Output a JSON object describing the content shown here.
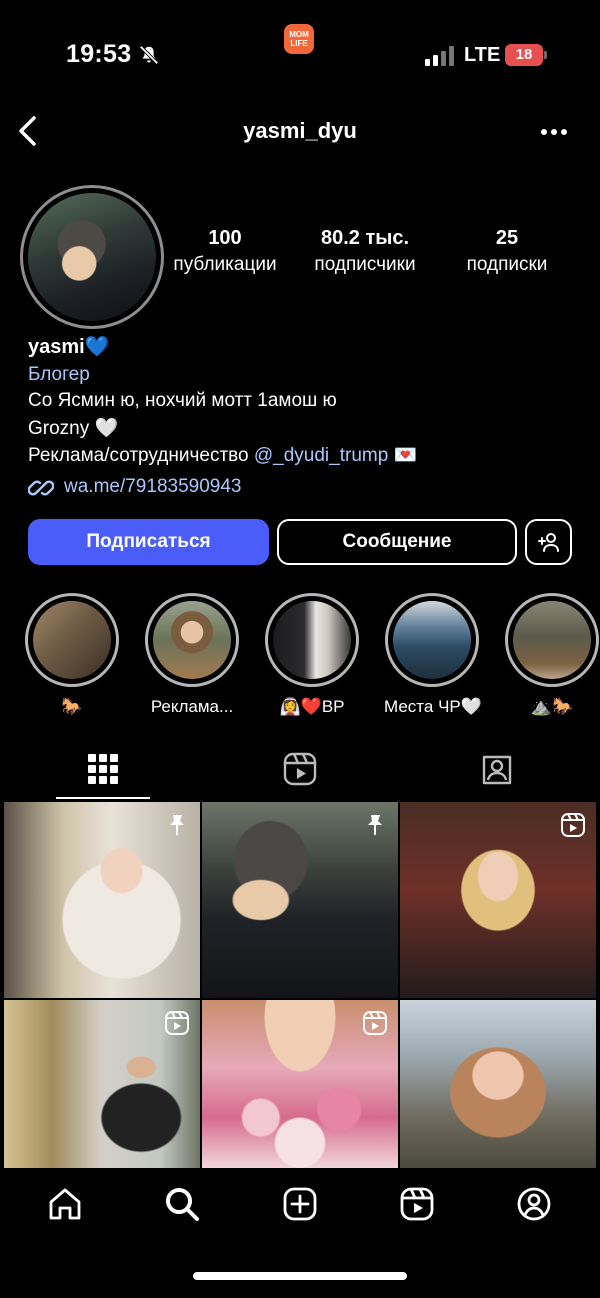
{
  "status_bar": {
    "time": "19:53",
    "app_badge": "MOM\nLIFE",
    "network": "LTE",
    "battery": "18"
  },
  "header": {
    "username": "yasmi_dyu"
  },
  "profile": {
    "stats": [
      {
        "value": "100",
        "label": "публикации"
      },
      {
        "value": "80.2 тыс.",
        "label": "подписчики"
      },
      {
        "value": "25",
        "label": "подписки"
      }
    ],
    "name": "yasmi💙",
    "category": "Блогер",
    "bio_line1": "Со Ясмин ю, нохчий мотт 1амош ю",
    "bio_line2": "Grozny 🤍",
    "bio_line3_prefix": "Реклама/сотрудничество ",
    "bio_line3_mention": "@_dyudi_trump",
    "bio_line3_suffix": " 💌",
    "link": "wa.me/79183590943"
  },
  "actions": {
    "follow_label": "Подписаться",
    "message_label": "Сообщение"
  },
  "highlights": [
    {
      "label": "🐎"
    },
    {
      "label": "Реклама..."
    },
    {
      "label": "👰‍♀️❤️BP"
    },
    {
      "label": "Места ЧР🤍"
    },
    {
      "label": "⛰️🐎"
    }
  ],
  "colors": {
    "accent_blue": "#4a5df9",
    "link_blue": "#a8c7fa",
    "background": "#000000"
  },
  "grid_badges": [
    "pin-icon",
    "pin-icon",
    "reel-icon",
    "reel-icon",
    "reel-icon",
    ""
  ]
}
